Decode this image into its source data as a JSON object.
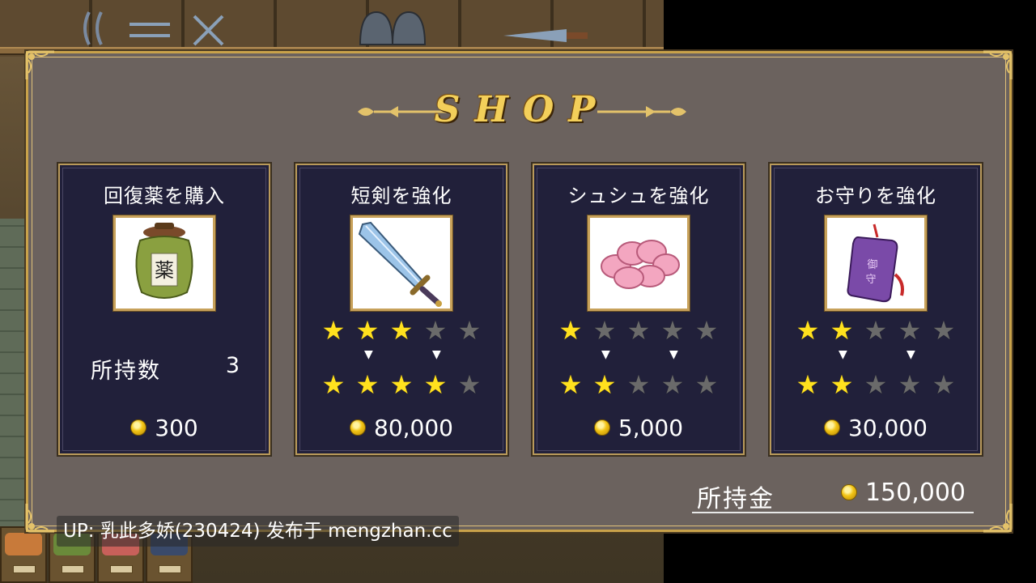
{
  "shop": {
    "title": "SHOP"
  },
  "cards": [
    {
      "title": "回復薬を購入",
      "item_icon": "medicine-jar-icon",
      "owned_label": "所持数",
      "owned_count": "3",
      "price": "300"
    },
    {
      "title": "短剣を強化",
      "item_icon": "dagger-icon",
      "stars_current": 3,
      "stars_next": 4,
      "stars_max": 5,
      "price": "80,000"
    },
    {
      "title": "シュシュを強化",
      "item_icon": "scrunchie-icon",
      "stars_current": 1,
      "stars_next": 2,
      "stars_max": 5,
      "price": "5,000"
    },
    {
      "title": "お守りを強化",
      "item_icon": "omamori-charm-icon",
      "stars_current": 2,
      "stars_next": 2,
      "stars_max": 5,
      "price": "30,000"
    }
  ],
  "money": {
    "label": "所持金",
    "value": "150,000"
  },
  "watermark": "UP: 乳此多娇(230424) 发布于 mengzhan.cc",
  "colors": {
    "star_on": "#ffe11e",
    "star_off": "#6a6a6a",
    "gold_frame": "#c9a24a",
    "card_bg": "#21203a",
    "panel_bg": "#6b625e",
    "title_gold": "#f3cf5a"
  }
}
